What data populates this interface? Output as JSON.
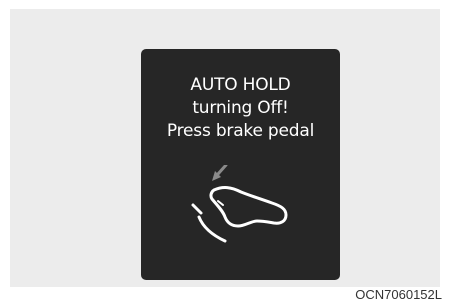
{
  "display": {
    "message_lines": [
      "AUTO HOLD",
      "turning Off!",
      "Press brake pedal"
    ],
    "icon": "brake-pedal-press-icon"
  },
  "figure_code": "OCN7060152L",
  "colors": {
    "page_background": "#ffffff",
    "panel_background": "#ececec",
    "display_background": "#262626",
    "message_text": "#ffffff",
    "arrow": "#8a8a8a"
  }
}
